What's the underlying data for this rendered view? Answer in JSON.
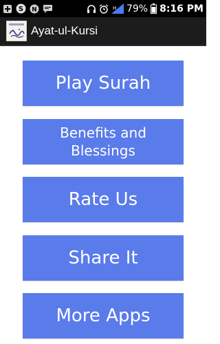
{
  "status_bar": {
    "battery_percent": "79%",
    "time": "8:16",
    "time_suffix": "PM",
    "icons": [
      "add-box-icon",
      "skype-icon",
      "note-icon",
      "message-icon",
      "headset-icon",
      "alarm-icon",
      "signal-icon",
      "battery-icon"
    ]
  },
  "action_bar": {
    "title": "Ayat-ul-Kursi"
  },
  "menu": {
    "play_label": "Play Surah",
    "benefits_label": "Benefits and Blessings",
    "rate_label": "Rate Us",
    "share_label": "Share It",
    "more_label": "More Apps"
  },
  "colors": {
    "button": "#5a7bea",
    "action_bar": "#1c1c1c",
    "status_bar": "#000000",
    "signal": "#4a7cf0"
  }
}
